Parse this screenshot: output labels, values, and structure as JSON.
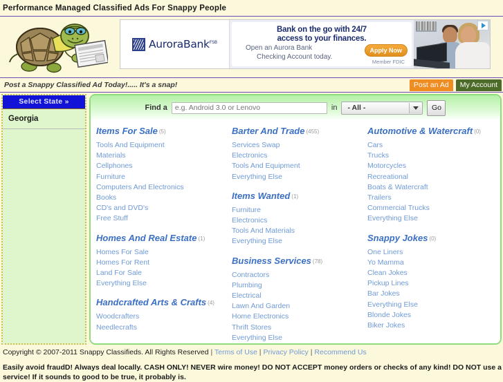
{
  "header": {
    "tagline": "Performance Managed Classified Ads For Snappy People",
    "logo_alt": "turtle-mascot-with-newspaper"
  },
  "ad": {
    "brand_first": "Aurora",
    "brand_second": "Bank",
    "brand_suffix": "FSB",
    "headline_line1": "Bank on the go with 24/7",
    "headline_line2": "access to your finances.",
    "sub_line1": "Open an Aurora Bank",
    "sub_line2": "Checking Account today.",
    "cta": "Apply Now",
    "fdic": "Member FDIC",
    "adchoices": "ad-choices-icon"
  },
  "subnav": {
    "slogan": "Post a Snappy Classified Ad Today!..... It's a snap!",
    "post_ad": "Post an Ad",
    "my_account": "My Account"
  },
  "sidebar": {
    "state_header": "Select State »",
    "selected_state": "Georgia"
  },
  "search": {
    "label": "Find a",
    "placeholder": "e.g. Android 3.0 or Lenovo",
    "in_label": "in",
    "selected_option": "- All -",
    "options": [
      "- All -"
    ],
    "go": "Go"
  },
  "columns": [
    {
      "groups": [
        {
          "title": "Items For Sale",
          "count": "(5)",
          "links": [
            "Tools And Equipment",
            "Materials",
            "Cellphones",
            "Furniture",
            "Computers And Electronics",
            "Books",
            "CD's and DVD's",
            "Free Stuff"
          ]
        },
        {
          "title": "Homes And Real Estate",
          "count": "(1)",
          "links": [
            "Homes For Sale",
            "Homes For Rent",
            "Land For Sale",
            "Everything Else"
          ]
        },
        {
          "title": "Handcrafted Arts & Crafts",
          "count": "(4)",
          "links": [
            "Woodcrafters",
            "Needlecrafts"
          ]
        }
      ]
    },
    {
      "groups": [
        {
          "title": "Barter And Trade",
          "count": "(455)",
          "links": [
            "Services Swap",
            "Electronics",
            "Tools And Equipment",
            "Everything Else"
          ]
        },
        {
          "title": "Items Wanted",
          "count": "(1)",
          "links": [
            "Furniture",
            "Electronics",
            "Tools And Materials",
            "Everything Else"
          ]
        },
        {
          "title": "Business Services",
          "count": "(78)",
          "links": [
            "Contractors",
            "Plumbing",
            "Electrical",
            "Lawn And Garden",
            "Home Electronics",
            "Thrift Stores",
            "Everything Else"
          ]
        }
      ]
    },
    {
      "groups": [
        {
          "title": "Automotive & Watercraft",
          "count": "(0)",
          "links": [
            "Cars",
            "Trucks",
            "Motorcycles",
            "Recreational",
            "Boats & Watercraft",
            "Trailers",
            "Commercial Trucks",
            "Everything Else"
          ]
        },
        {
          "title": "Snappy Jokes",
          "count": "(0)",
          "links": [
            "One Liners",
            "Yo Mamma",
            "Clean Jokes",
            "Pickup Lines",
            "Bar Jokes",
            "Everything Else",
            "Blonde Jokes",
            "Biker Jokes"
          ]
        }
      ]
    }
  ],
  "footer": {
    "copyright": "Copyright © 2007-2011 Snappy Classifieds. All Rights Reserved",
    "terms": "Terms of Use",
    "privacy": "Privacy Policy",
    "recommend": "Recommend Us",
    "warning_line1": "Easily avoid fraudD!  Always deal locally.   CASH ONLY!  NEVER wire money!  DO NOT ACCEPT money orders or checks of any kind!  DO NOT use an escrow",
    "warning_line2": "service!  If it sounds to good to be true,  it probably is."
  },
  "colors": {
    "page_bg": "#fcf8dc",
    "accent_green": "#8ddc7e",
    "link_blue": "#6f9ad6",
    "heading_blue": "#3a6fc4",
    "state_blue": "#1313d8",
    "post_orange": "#ef8c22",
    "account_green": "#4c6b29",
    "sidebar_green": "#dff5cb"
  }
}
